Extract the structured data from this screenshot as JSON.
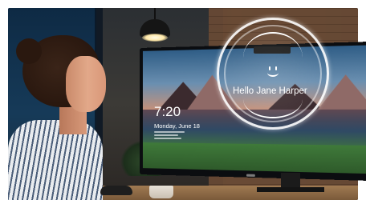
{
  "lock_screen": {
    "time": "7:20",
    "date": "Monday, June 18"
  },
  "face_recognition": {
    "greeting": "Hello Jane Harper",
    "icon": "smile-icon"
  },
  "colors": {
    "ring": "#ffffff",
    "text": "#ffffff"
  }
}
